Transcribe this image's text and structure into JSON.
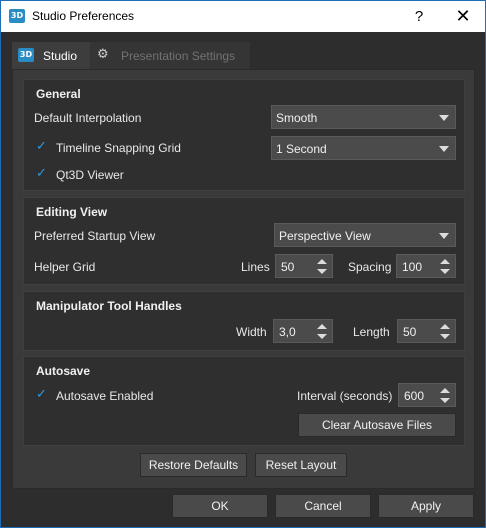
{
  "window": {
    "title": "Studio Preferences",
    "help": "?",
    "close": "✕",
    "app_icon": "3D"
  },
  "tabs": [
    {
      "label": "Studio",
      "icon": "3d-icon"
    },
    {
      "label": "Presentation Settings",
      "icon": "gear-icon"
    }
  ],
  "general": {
    "title": "General",
    "interpolation_label": "Default Interpolation",
    "interpolation_value": "Smooth",
    "snapping_label": "Timeline Snapping Grid",
    "snapping_checked": true,
    "snapping_value": "1 Second",
    "qt3d_label": "Qt3D Viewer",
    "qt3d_checked": true
  },
  "editing": {
    "title": "Editing View",
    "startup_label": "Preferred Startup View",
    "startup_value": "Perspective View",
    "helper_label": "Helper Grid",
    "lines_label": "Lines",
    "lines_value": "50",
    "spacing_label": "Spacing",
    "spacing_value": "100"
  },
  "manipulator": {
    "title": "Manipulator Tool Handles",
    "width_label": "Width",
    "width_value": "3,0",
    "length_label": "Length",
    "length_value": "50"
  },
  "autosave": {
    "title": "Autosave",
    "enabled_label": "Autosave Enabled",
    "enabled_checked": true,
    "interval_label": "Interval (seconds)",
    "interval_value": "600",
    "clear_label": "Clear Autosave Files"
  },
  "bottom": {
    "restore_label": "Restore Defaults",
    "reset_label": "Reset Layout"
  },
  "dialog_buttons": {
    "ok_label": "OK",
    "cancel_label": "Cancel",
    "apply_label": "Apply"
  },
  "colors": {
    "accent": "#2f9ae0",
    "brand_icon": "#2a8cc4",
    "window_border": "#1c6fb7"
  }
}
